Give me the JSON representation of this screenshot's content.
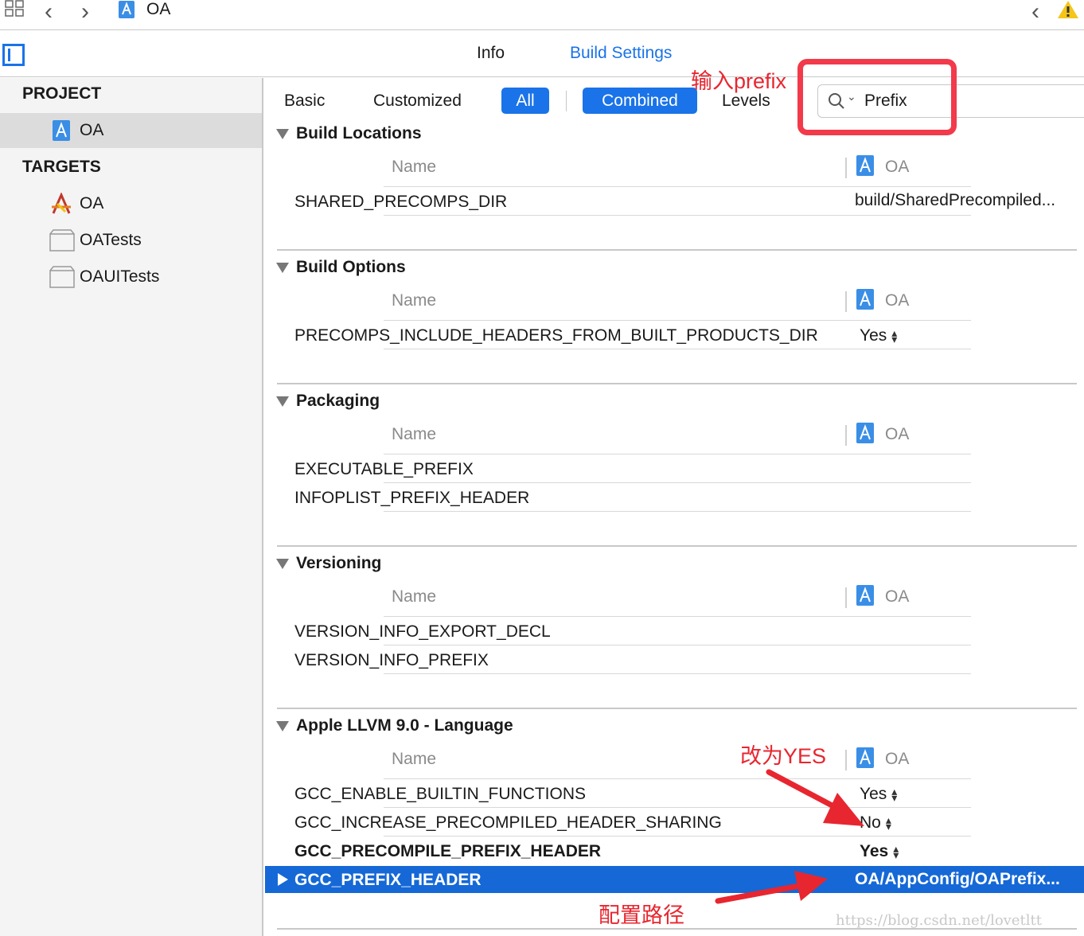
{
  "toolbar": {
    "breadcrumb": "OA"
  },
  "tabs": {
    "info": "Info",
    "build_settings": "Build Settings"
  },
  "sidebar": {
    "project_header": "PROJECT",
    "project_item": "OA",
    "targets_header": "TARGETS",
    "targets": [
      "OA",
      "OATests",
      "OAUITests"
    ]
  },
  "filter": {
    "basic": "Basic",
    "customized": "Customized",
    "all": "All",
    "combined": "Combined",
    "levels": "Levels",
    "search_value": "Prefix"
  },
  "annotations": {
    "input_prefix": "输入prefix",
    "change_yes": "改为YES",
    "config_path": "配置路径"
  },
  "column": {
    "name": "Name",
    "target": "OA"
  },
  "groups": [
    {
      "title": "Build Locations",
      "rows": [
        {
          "name": "SHARED_PRECOMPS_DIR",
          "value": "build/SharedPrecompiled..."
        }
      ]
    },
    {
      "title": "Build Options",
      "rows": [
        {
          "name": "PRECOMPS_INCLUDE_HEADERS_FROM_BUILT_PRODUCTS_DIR",
          "value": "Yes"
        }
      ]
    },
    {
      "title": "Packaging",
      "rows": [
        {
          "name": "EXECUTABLE_PREFIX",
          "value": ""
        },
        {
          "name": "INFOPLIST_PREFIX_HEADER",
          "value": ""
        }
      ]
    },
    {
      "title": "Versioning",
      "rows": [
        {
          "name": "VERSION_INFO_EXPORT_DECL",
          "value": ""
        },
        {
          "name": "VERSION_INFO_PREFIX",
          "value": ""
        }
      ]
    },
    {
      "title": "Apple LLVM 9.0 - Language",
      "rows": [
        {
          "name": "GCC_ENABLE_BUILTIN_FUNCTIONS",
          "value": "Yes"
        },
        {
          "name": "GCC_INCREASE_PRECOMPILED_HEADER_SHARING",
          "value": "No"
        },
        {
          "name": "GCC_PRECOMPILE_PREFIX_HEADER",
          "value": "Yes"
        }
      ]
    }
  ],
  "selected_row": {
    "name": "GCC_PREFIX_HEADER",
    "value": "OA/AppConfig/OAPrefix..."
  },
  "watermark": "https://blog.csdn.net/lovetltt",
  "colors": {
    "accent": "#1a73e8",
    "annotation": "#e8262f",
    "selection": "#1568d6"
  }
}
